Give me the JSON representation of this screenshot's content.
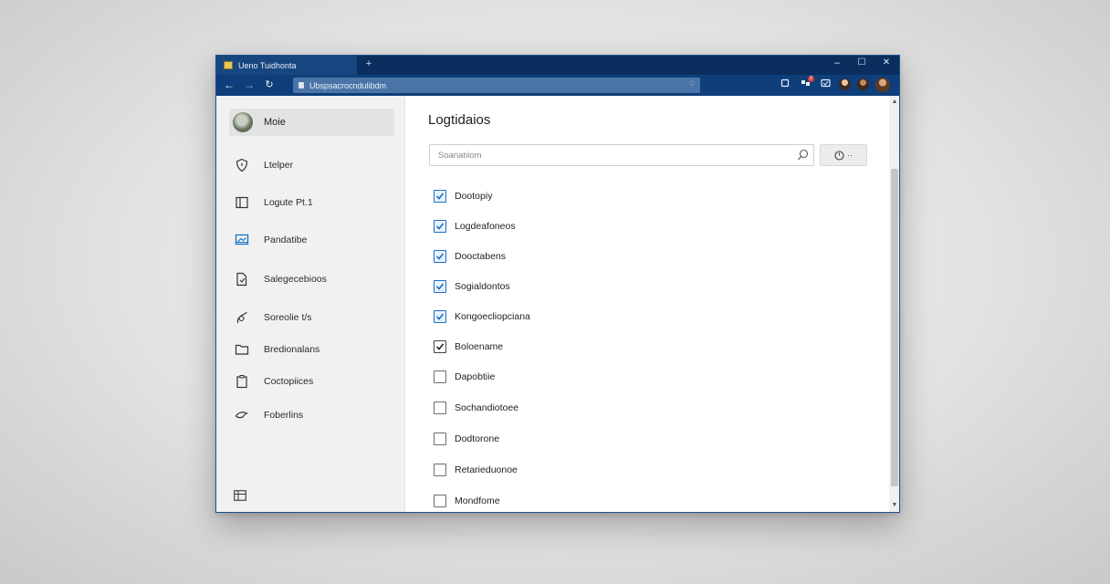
{
  "browser": {
    "tab_title": "Ueno Tuidhonta",
    "new_tab": "+",
    "url": "Ubspsacrocndulibdm",
    "window_controls": {
      "minimize": "–",
      "maximize": "☐",
      "close": "✕"
    },
    "notification_badge": "2",
    "accent_color": "#0e3f7a"
  },
  "sidebar": {
    "profile_name": "Moie",
    "items": [
      {
        "label": "Ltelper",
        "icon": "shield-icon"
      },
      {
        "label": "Logute Pt.1",
        "icon": "book-icon"
      },
      {
        "label": "Pandatibe",
        "icon": "monitor-icon"
      },
      {
        "label": "Salegecebioos",
        "icon": "document-icon"
      },
      {
        "label": "Soreolie t/s",
        "icon": "pen-icon"
      },
      {
        "label": "Bredionalans",
        "icon": "folder-icon"
      },
      {
        "label": "Coctopiices",
        "icon": "clipboard-icon"
      },
      {
        "label": "Foberlins",
        "icon": "hand-icon"
      }
    ]
  },
  "main": {
    "title": "Logtidaios",
    "search_placeholder": "Soanatiiom",
    "filter_label": "··",
    "options": [
      {
        "label": "Dootopiy",
        "checked": true
      },
      {
        "label": "Logdeafoneos",
        "checked": true
      },
      {
        "label": "Dooctabens",
        "checked": true
      },
      {
        "label": "Sogialdontos",
        "checked": true
      },
      {
        "label": "Kongoecliopciana",
        "checked": true
      },
      {
        "label": "Boloename",
        "checked": true
      },
      {
        "label": "Dapobtiie",
        "checked": false
      },
      {
        "label": "Sochandiotoee",
        "checked": false
      },
      {
        "label": "Dodtorone",
        "checked": false
      },
      {
        "label": "Retarieduonoe",
        "checked": false
      },
      {
        "label": "Mondfome",
        "checked": false
      }
    ]
  }
}
